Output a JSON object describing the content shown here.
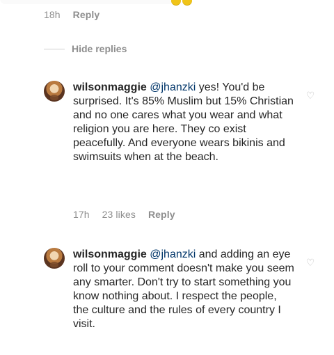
{
  "top_meta": {
    "time": "18h",
    "reply_label": "Reply"
  },
  "thread": {
    "hide_replies_label": "Hide replies"
  },
  "comments": [
    {
      "username": "wilsonmaggie",
      "mention": "@jhanzki",
      "text_after_mention": " yes! You'd be surprised. It's 85% Muslim but 15% Christian and no one cares what you wear and what religion you are here. They co exist peacefully. And everyone wears bikinis and swimsuits when at the beach.",
      "time": "17h",
      "likes_label": "23 likes",
      "reply_label": "Reply"
    },
    {
      "username": "wilsonmaggie",
      "mention": "@jhanzki",
      "text_after_mention": " and adding an eye roll to your comment doesn't make you seem any smarter. Don't try to start something you know nothing about. I respect the people, the culture and the rules of every country I visit."
    }
  ],
  "icons": {
    "heart": "heart-outline-icon",
    "avatar": "avatar-icon"
  },
  "colors": {
    "text": "#262626",
    "meta": "#8e8e8e",
    "mention": "#003569",
    "icon": "#bbbbbb",
    "background": "#ffffff"
  }
}
